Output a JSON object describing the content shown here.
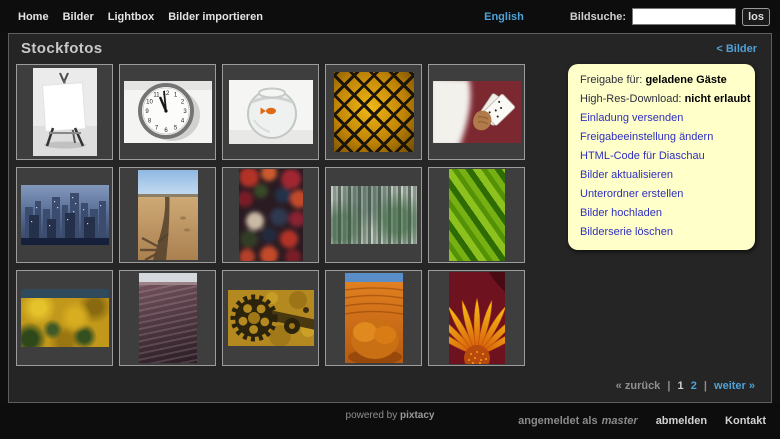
{
  "topbar": {
    "menu": [
      {
        "label": "Home"
      },
      {
        "label": "Bilder"
      },
      {
        "label": "Lightbox"
      },
      {
        "label": "Bilder importieren"
      }
    ],
    "language_link": "English",
    "search": {
      "label": "Bildsuche:",
      "value": "",
      "button": "los"
    }
  },
  "panel": {
    "title": "Stockfotos",
    "back_link": "< Bilder"
  },
  "actions": {
    "info": [
      {
        "label": "Freigabe für:",
        "value": "geladene Gäste"
      },
      {
        "label": "High-Res-Download:",
        "value": "nicht erlaubt"
      }
    ],
    "links": [
      "Einladung versenden",
      "Freigabeeinstellung ändern",
      "HTML-Code für Diaschau",
      "Bilder aktualisieren",
      "Unterordner erstellen",
      "Bilder hochladen",
      "Bilderserie löschen"
    ]
  },
  "gallery": {
    "thumbnails": [
      {
        "name": "canvas-on-easel"
      },
      {
        "name": "wall-clock"
      },
      {
        "name": "goldfish-bowl"
      },
      {
        "name": "chain-link-fence"
      },
      {
        "name": "hand-with-playing-cards"
      },
      {
        "name": "city-skyline-dusk"
      },
      {
        "name": "palm-tree-shadow-beach"
      },
      {
        "name": "autumn-leaves"
      },
      {
        "name": "birch-forest"
      },
      {
        "name": "green-palm-leaves"
      },
      {
        "name": "autumn-hillside"
      },
      {
        "name": "dark-sand-dune"
      },
      {
        "name": "rusty-gears"
      },
      {
        "name": "orange-dune-with-bush"
      },
      {
        "name": "orange-gerbera"
      }
    ]
  },
  "pagination": {
    "prev": "« zurück",
    "separator": "|",
    "pages": [
      "1",
      "2"
    ],
    "current_page": "1",
    "next": "weiter »"
  },
  "footer": {
    "powered_prefix": "powered by",
    "brand": "pixtacy",
    "logged_in_label": "angemeldet als",
    "username": "master",
    "logout_link": "abmelden",
    "contact_link": "Kontakt"
  },
  "colors": {
    "accent_blue": "#4fa2d8",
    "action_link_blue": "#2f2fc0",
    "note_background": "#ffffca"
  }
}
